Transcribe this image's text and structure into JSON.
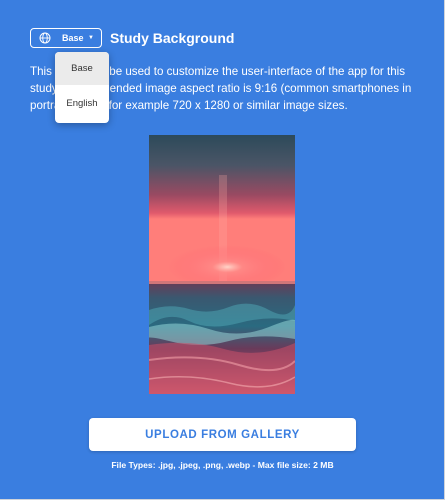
{
  "language_select": {
    "value": "Base",
    "options": [
      "Base",
      "English"
    ]
  },
  "title": "Study Background",
  "description": "This image will be used to customize the user-interface of the app for this study. Recommended image aspect ratio is 9:16 (common smartphones in portrait mode), for example 720 x 1280 or similar image sizes.",
  "preview_image": "sunset-over-sea",
  "upload_button": "UPLOAD FROM GALLERY",
  "file_info": "File Types: .jpg, .jpeg, .png, .webp - Max file size: 2 MB",
  "colors": {
    "background": "#3a7ee0",
    "button_text": "#3a7ee0"
  }
}
